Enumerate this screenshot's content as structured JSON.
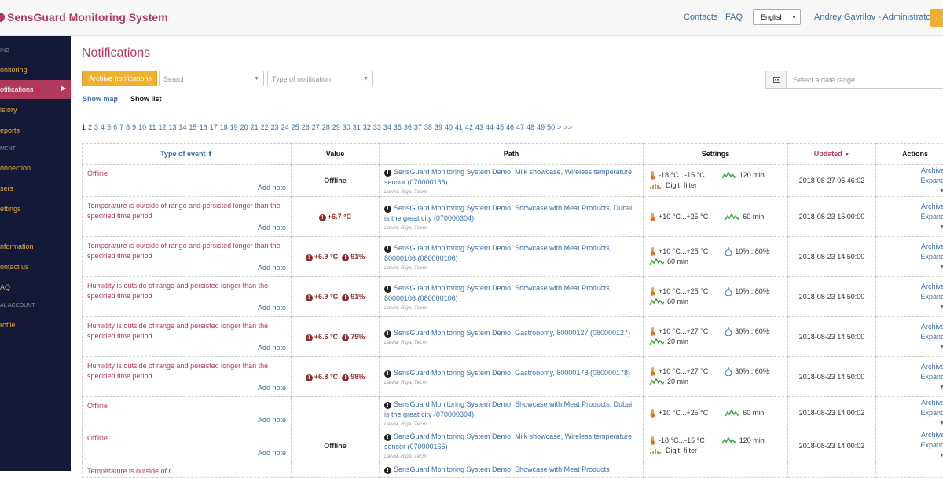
{
  "header": {
    "app_title": "SensGuard Monitoring System",
    "contacts": "Contacts",
    "faq": "FAQ",
    "language": "English",
    "user": "Andrey Gavrilov - Administrator",
    "logout": "Lo"
  },
  "sidebar": {
    "sections": [
      {
        "heading": "ING",
        "items": [
          "Monitoring",
          "Notifications",
          "History",
          "Reports"
        ]
      },
      {
        "heading": "MENT",
        "items": [
          "Connection",
          "Users",
          "Settings"
        ]
      },
      {
        "heading": "",
        "items": [
          "Information",
          "Contact us",
          "FAQ"
        ]
      },
      {
        "heading": "AL ACCOUNT",
        "items": [
          "Profile"
        ]
      }
    ],
    "labels": {
      "s0": "ING",
      "i0": "onitoring",
      "i1": "otifications",
      "i2": "istory",
      "i3": "eports",
      "s1": "MENT",
      "i4": "onnection",
      "i5": "sers",
      "i6": "ettings",
      "i7": "nformation",
      "i8": "ontact us",
      "i9": "AQ",
      "s3": "AL ACCOUNT",
      "i10": "rofile"
    },
    "active": "Notifications"
  },
  "page": {
    "title": "Notifications",
    "archive_btn": "Archive notifications",
    "search_placeholder": "Search",
    "type_placeholder": "Type of notification",
    "date_placeholder": "Select a date range",
    "show_map": "Show map",
    "show_list": "Show list"
  },
  "pager": {
    "current": "1",
    "pages": [
      "2",
      "3",
      "4",
      "5",
      "6",
      "7",
      "8",
      "9",
      "10",
      "11",
      "12",
      "13",
      "14",
      "15",
      "16",
      "17",
      "18",
      "19",
      "20",
      "21",
      "22",
      "23",
      "24",
      "25",
      "26",
      "27",
      "28",
      "29",
      "30",
      "31",
      "32",
      "33",
      "34",
      "35",
      "36",
      "37",
      "38",
      "39",
      "40",
      "41",
      "42",
      "43",
      "44",
      "45",
      "46",
      "47",
      "48",
      "49",
      "50"
    ],
    "next": ">",
    "last": ">>"
  },
  "table": {
    "headers": {
      "type": "Type of event",
      "type_sort": "⬍",
      "value": "Value",
      "path": "Path",
      "settings": "Settings",
      "updated": "Updated",
      "updated_sort": "▼",
      "actions": "Actions"
    },
    "add_note": "Add note",
    "archive": "Archive",
    "expand": "Expand",
    "rows": [
      {
        "event": "Offline",
        "value": "Offline",
        "path": "SensGuard Monitoring System Demo, Milk showcase, Wireless temperature sensor (070000166)",
        "location": "Latvia, Riga, Тест",
        "temp": "-18 °C...-15 °C",
        "time": "120 min",
        "extra": "Digit. filter",
        "updated": "2018-08-27 05:46:02"
      },
      {
        "event": "Temperature is outside of range and persisted longer than the specified time period",
        "value": "+6.7 °C",
        "path": "SensGuard Monitoring System Demo, Showcase with Meat Products, Dubai is the great city (070000304)",
        "location": "Latvia, Riga, Тест",
        "temp": "+10 °C...+25 °C",
        "time": "60 min",
        "updated": "2018-08-23 15:00:00"
      },
      {
        "event": "Temperature is outside of range and persisted longer than the specified time period",
        "value": "+6.9 °C,",
        "value2": "91%",
        "path": "SensGuard Monitoring System Demo, Showcase with Meat Products, 80000106 (080000106)",
        "location": "Latvia, Riga, Тест",
        "temp": "+10 °C...+25 °C",
        "hum": "10%...80%",
        "time": "60 min",
        "updated": "2018-08-23 14:50:00"
      },
      {
        "event": "Humidity is outside of range and persisted longer than the specified time period",
        "value": "+6.9 °C,",
        "value2": "91%",
        "path": "SensGuard Monitoring System Demo, Showcase with Meat Products, 80000106 (080000106)",
        "location": "Latvia, Riga, Тест",
        "temp": "+10 °C...+25 °C",
        "hum": "10%...80%",
        "time": "60 min",
        "updated": "2018-08-23 14:50:00"
      },
      {
        "event": "Humidity is outside of range and persisted longer than the specified time period",
        "value": "+6.6 °C,",
        "value2": "79%",
        "path": "SensGuard Monitoring System Demo, Gastronomy, 80000127 (080000127)",
        "location": "Latvia, Riga, Тест",
        "temp": "+10 °C...+27 °C",
        "hum": "30%...60%",
        "time": "20 min",
        "updated": "2018-08-23 14:50:00"
      },
      {
        "event": "Humidity is outside of range and persisted longer than the specified time period",
        "value": "+6.8 °C,",
        "value2": "98%",
        "path": "SensGuard Monitoring System Demo, Gastronomy, 80000178 (080000178)",
        "location": "Latvia, Riga, Тест",
        "temp": "+10 °C...+27 °C",
        "hum": "30%...60%",
        "time": "20 min",
        "updated": "2018-08-23 14:50:00"
      },
      {
        "event": "Offline",
        "value": "",
        "path": "SensGuard Monitoring System Demo, Showcase with Meat Products, Dubai is the great city (070000304)",
        "location": "Latvia, Riga, Тест",
        "temp": "+10 °C...+25 °C",
        "time": "60 min",
        "updated": "2018-08-23 14:00:02"
      },
      {
        "event": "Offline",
        "value": "Offline",
        "path": "SensGuard Monitoring System Demo, Milk showcase, Wireless temperature sensor (070000166)",
        "location": "Latvia, Riga, Тест",
        "temp": "-18 °C...-15 °C",
        "time": "120 min",
        "extra": "Digit. filter",
        "updated": "2018-08-23 14:00:02"
      },
      {
        "event": "Temperature is outside of r",
        "path": "SensGuard Monitoring System Demo, Showcase with Meat Products"
      }
    ]
  },
  "colors": {
    "accent": "#b03a5b",
    "sidebar": "#131936",
    "button": "#efb030",
    "link": "#3a6ea5"
  }
}
